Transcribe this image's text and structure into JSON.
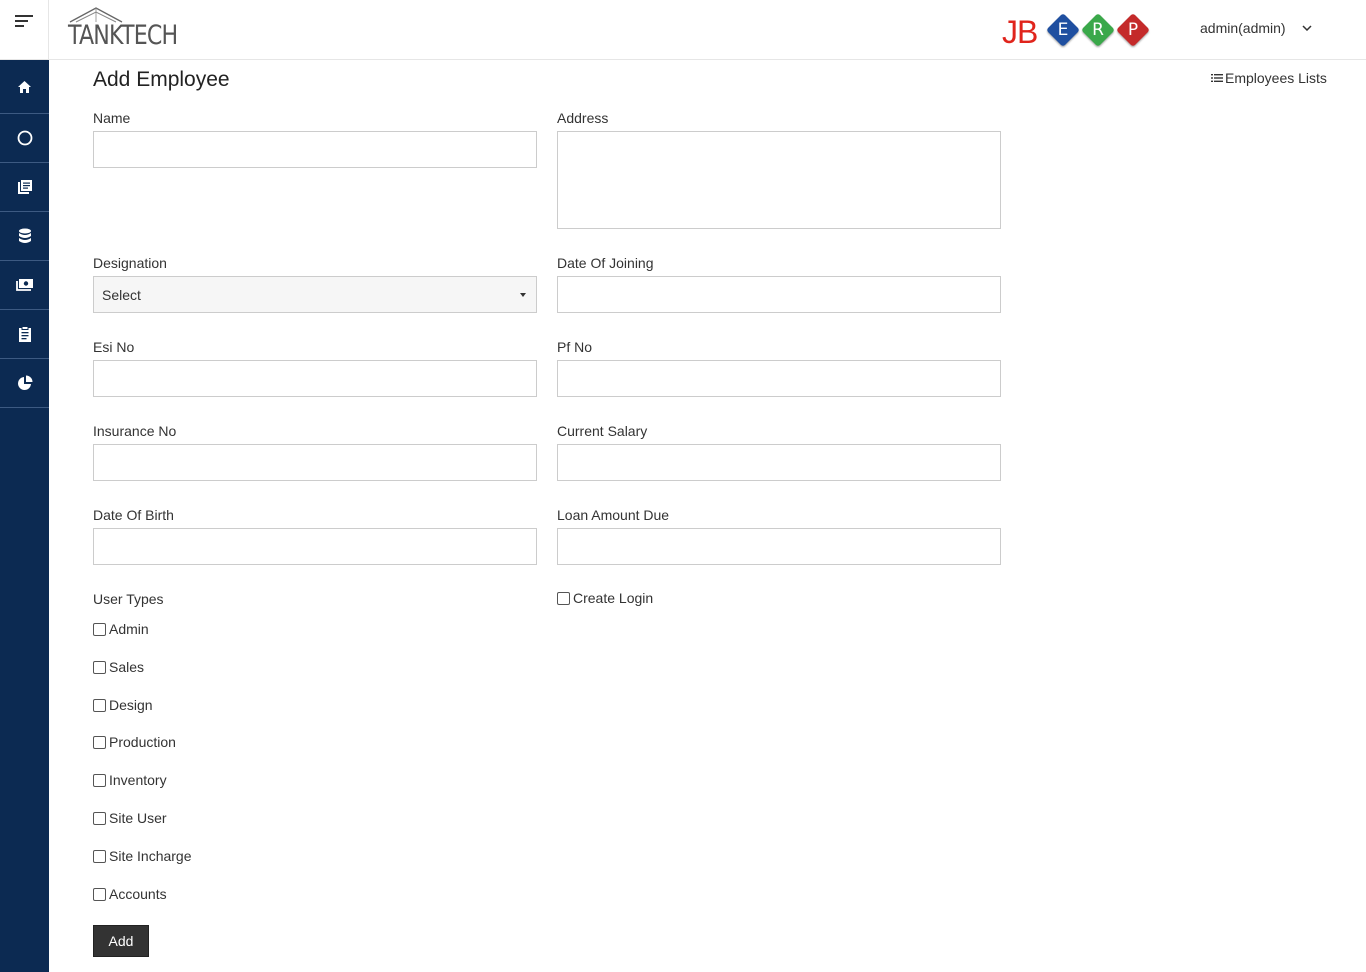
{
  "header": {
    "brand": "TANKTECH",
    "erp_logo": {
      "prefix": "JB",
      "letters": [
        "E",
        "R",
        "P"
      ],
      "colors": [
        "#1f4fa0",
        "#3aa84a",
        "#c42a2a"
      ]
    },
    "user_label": "admin(admin)"
  },
  "sidebar": {
    "items": [
      {
        "icon": "home-icon"
      },
      {
        "icon": "circle-icon"
      },
      {
        "icon": "books-icon"
      },
      {
        "icon": "database-icon"
      },
      {
        "icon": "money-icon"
      },
      {
        "icon": "clipboard-icon"
      },
      {
        "icon": "pie-chart-icon"
      }
    ],
    "color": "#0c2a52"
  },
  "page": {
    "title": "Add Employee",
    "list_link": "Employees Lists"
  },
  "form": {
    "name": {
      "label": "Name",
      "value": ""
    },
    "address": {
      "label": "Address",
      "value": ""
    },
    "designation": {
      "label": "Designation",
      "selected": "Select"
    },
    "date_of_joining": {
      "label": "Date Of Joining",
      "value": ""
    },
    "esi_no": {
      "label": "Esi No",
      "value": ""
    },
    "pf_no": {
      "label": "Pf No",
      "value": ""
    },
    "insurance_no": {
      "label": "Insurance No",
      "value": ""
    },
    "current_salary": {
      "label": "Current Salary",
      "value": ""
    },
    "date_of_birth": {
      "label": "Date Of Birth",
      "value": ""
    },
    "loan_amount_due": {
      "label": "Loan Amount Due",
      "value": ""
    },
    "user_types_label": "User Types",
    "user_types": [
      "Admin",
      "Sales",
      "Design",
      "Production",
      "Inventory",
      "Site User",
      "Site Incharge",
      "Accounts"
    ],
    "create_login": "Create Login",
    "submit": "Add"
  }
}
